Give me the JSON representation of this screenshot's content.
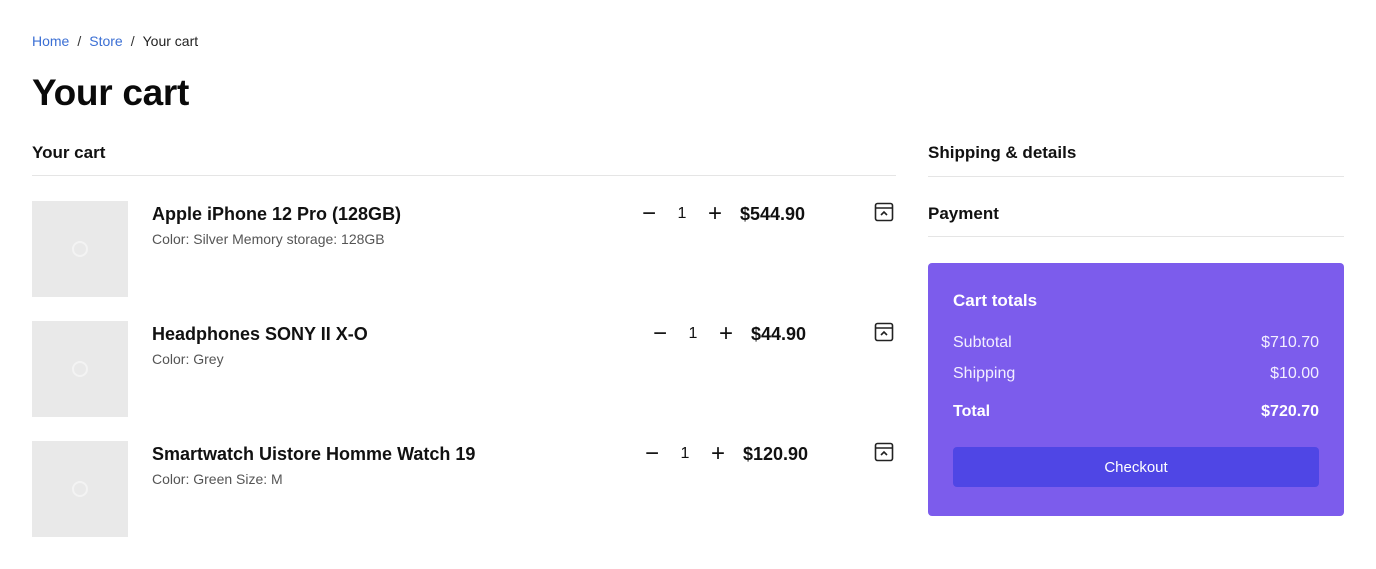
{
  "breadcrumb": {
    "home": "Home",
    "store": "Store",
    "current": "Your cart",
    "separator": "/"
  },
  "page_title": "Your cart",
  "cart": {
    "heading": "Your cart",
    "items": [
      {
        "name": "Apple iPhone 12 Pro (128GB)",
        "meta": "Color: Silver Memory storage: 128GB",
        "quantity": "1",
        "price": "$544.90",
        "decrease": "−",
        "increase": "+"
      },
      {
        "name": "Headphones SONY II X-O",
        "meta": "Color: Grey",
        "quantity": "1",
        "price": "$44.90",
        "decrease": "−",
        "increase": "+"
      },
      {
        "name": "Smartwatch Uistore Homme Watch 19",
        "meta": "Color: Green Size: M",
        "quantity": "1",
        "price": "$120.90",
        "decrease": "−",
        "increase": "+"
      }
    ]
  },
  "side": {
    "shipping_heading": "Shipping & details",
    "payment_heading": "Payment"
  },
  "totals": {
    "title": "Cart totals",
    "subtotal_label": "Subtotal",
    "subtotal_value": "$710.70",
    "shipping_label": "Shipping",
    "shipping_value": "$10.00",
    "total_label": "Total",
    "total_value": "$720.70",
    "checkout_label": "Checkout"
  },
  "colors": {
    "link": "#3b6fd4",
    "totals_bg": "#7c5cec",
    "checkout_bg": "#4f46e5",
    "thumb_bg": "#e9e9e9"
  },
  "icons": {
    "remove": "archive-remove-icon",
    "thumbnail": "image-placeholder-icon"
  }
}
